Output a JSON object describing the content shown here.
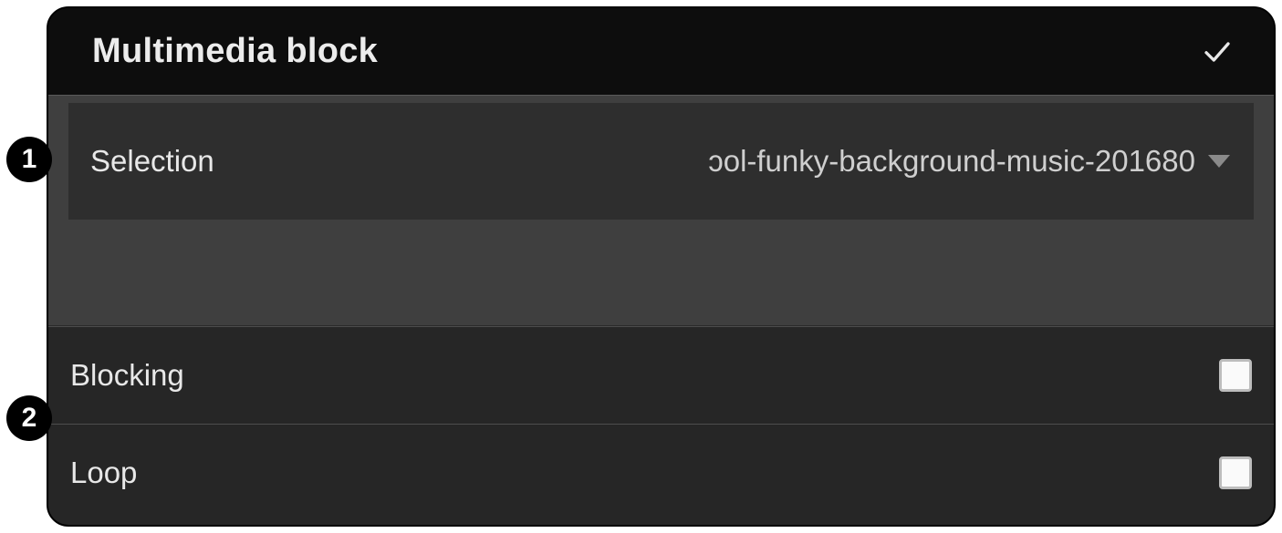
{
  "header": {
    "title": "Multimedia block"
  },
  "selection": {
    "label": "Selection",
    "value": "ᴐol-funky-background-music-201680"
  },
  "rows": {
    "blocking": {
      "label": "Blocking",
      "checked": false
    },
    "loop": {
      "label": "Loop",
      "checked": false
    }
  },
  "badges": {
    "one": "1",
    "two": "2"
  }
}
